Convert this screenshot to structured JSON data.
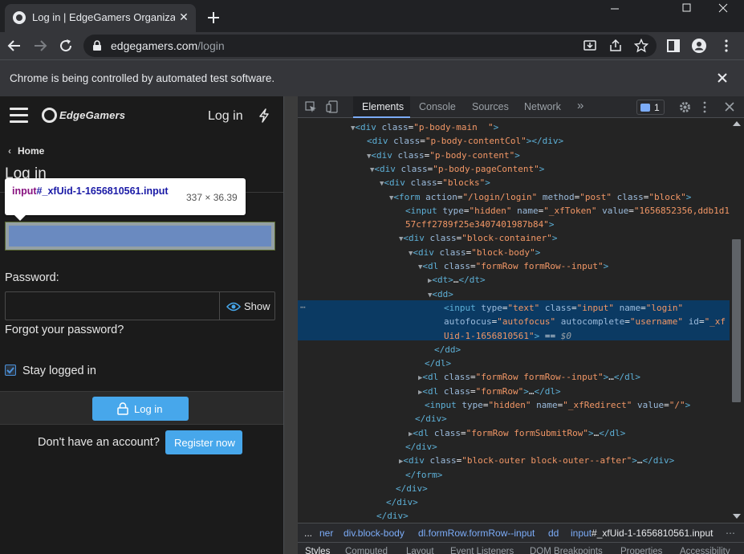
{
  "browser": {
    "tab_title": "Log in | EdgeGamers Organizatio",
    "url_domain": "edgegamers.com",
    "url_path": "/login",
    "infobar_message": "Chrome is being controlled by automated test software."
  },
  "site": {
    "logo_text": "EdgeGamers",
    "header_login": "Log in",
    "breadcrumb": "Home",
    "page_title": "Log in",
    "password_label": "Password:",
    "show_label": "Show",
    "forgot_password": "Forgot your password?",
    "stay_logged_in": "Stay logged in",
    "login_button": "Log in",
    "no_account": "Don't have an account?",
    "register_button": "Register now"
  },
  "tooltip": {
    "selector_tag": "input",
    "selector_rest": "#_xfUid-1-1656810561.input",
    "dimensions": "337 × 36.39"
  },
  "devtools": {
    "tabs": [
      "Elements",
      "Console",
      "Sources",
      "Network"
    ],
    "issues_count": "1",
    "dom_lines": [
      {
        "html": "<span class=\"arrow\">▼</span><span class=\"tag\">&lt;div</span> <span class=\"an\">class</span>=<span class=\"av\">\"p-body-main  \"</span><span class=\"tag\">&gt;</span>"
      },
      {
        "html": "<span class=\"tag\">&lt;div</span> <span class=\"an\">class</span>=<span class=\"av\">\"p-body-contentCol\"</span><span class=\"tag\">&gt;&lt;/div&gt;</span>"
      },
      {
        "html": "<span class=\"arrow\">▼</span><span class=\"tag\">&lt;div</span> <span class=\"an\">class</span>=<span class=\"av\">\"p-body-content\"</span><span class=\"tag\">&gt;</span>"
      },
      {
        "html": "<span class=\"arrow\">▼</span><span class=\"tag\">&lt;div</span> <span class=\"an\">class</span>=<span class=\"av\">\"p-body-pageContent\"</span><span class=\"tag\">&gt;</span>"
      },
      {
        "html": "<span class=\"arrow\">▼</span><span class=\"tag\">&lt;div</span> <span class=\"an\">class</span>=<span class=\"av\">\"blocks\"</span><span class=\"tag\">&gt;</span>"
      },
      {
        "html": "<span class=\"arrow\">▼</span><span class=\"tag\">&lt;form</span> <span class=\"an\">action</span>=<span class=\"av\">\"/login/login\"</span> <span class=\"an\">method</span>=<span class=\"av\">\"post\"</span> <span class=\"an\">class</span>=<span class=\"av\">\"block\"</span><span class=\"tag\">&gt;</span>"
      },
      {
        "html": "<span class=\"tag\">&lt;input</span> <span class=\"an\">type</span>=<span class=\"av\">\"hidden\"</span> <span class=\"an\">name</span>=<span class=\"av\">\"_xfToken\"</span> <span class=\"an\">value</span>=<span class=\"av\">\"1656852356,ddb1d1</span>"
      },
      {
        "html": "<span class=\"av\">57cff2789f25e3407401987b84\"</span><span class=\"tag\">&gt;</span>"
      },
      {
        "html": "<span class=\"arrow\">▼</span><span class=\"tag\">&lt;div</span> <span class=\"an\">class</span>=<span class=\"av\">\"block-container\"</span><span class=\"tag\">&gt;</span>"
      },
      {
        "html": "<span class=\"arrow\">▼</span><span class=\"tag\">&lt;div</span> <span class=\"an\">class</span>=<span class=\"av\">\"block-body\"</span><span class=\"tag\">&gt;</span>"
      },
      {
        "html": "<span class=\"arrow\">▼</span><span class=\"tag\">&lt;dl</span> <span class=\"an\">class</span>=<span class=\"av\">\"formRow formRow--input\"</span><span class=\"tag\">&gt;</span>"
      },
      {
        "html": "<span class=\"arrow\">▶</span><span class=\"tag\">&lt;dt&gt;</span>…<span class=\"tag\">&lt;/dt&gt;</span>"
      },
      {
        "html": "<span class=\"arrow\">▼</span><span class=\"tag\">&lt;dd&gt;</span>"
      },
      {
        "html": "<span class=\"tag\">&lt;input</span> <span class=\"an\">type</span>=<span class=\"av\">\"text\"</span> <span class=\"an\">class</span>=<span class=\"av\">\"input\"</span> <span class=\"an\">name</span>=<span class=\"av\">\"login\"</span>"
      },
      {
        "html": "<span class=\"an\">autofocus</span>=<span class=\"av\">\"autofocus\"</span> <span class=\"an\">autocomplete</span>=<span class=\"av\">\"username\"</span> <span class=\"an\">id</span>=<span class=\"av\">\"_xf</span>"
      },
      {
        "html": "<span class=\"av\">Uid-1-1656810561\"</span><span class=\"tag\">&gt;</span> == <span style=\"color:#9aa0a6;font-style:italic\">$0</span>"
      },
      {
        "html": "<span class=\"tag\">&lt;/dd&gt;</span>"
      },
      {
        "html": "<span class=\"tag\">&lt;/dl&gt;</span>"
      },
      {
        "html": "<span class=\"arrow\">▶</span><span class=\"tag\">&lt;dl</span> <span class=\"an\">class</span>=<span class=\"av\">\"formRow formRow--input\"</span><span class=\"tag\">&gt;</span>…<span class=\"tag\">&lt;/dl&gt;</span>"
      },
      {
        "html": "<span class=\"arrow\">▶</span><span class=\"tag\">&lt;dl</span> <span class=\"an\">class</span>=<span class=\"av\">\"formRow\"</span><span class=\"tag\">&gt;</span>…<span class=\"tag\">&lt;/dl&gt;</span>"
      },
      {
        "html": "<span class=\"tag\">&lt;input</span> <span class=\"an\">type</span>=<span class=\"av\">\"hidden\"</span> <span class=\"an\">name</span>=<span class=\"av\">\"_xfRedirect\"</span> <span class=\"an\">value</span>=<span class=\"av\">\"/\"</span><span class=\"tag\">&gt;</span>"
      },
      {
        "html": "<span class=\"tag\">&lt;/div&gt;</span>"
      },
      {
        "html": "<span class=\"arrow\">▶</span><span class=\"tag\">&lt;dl</span> <span class=\"an\">class</span>=<span class=\"av\">\"formRow formSubmitRow\"</span><span class=\"tag\">&gt;</span>…<span class=\"tag\">&lt;/dl&gt;</span>"
      },
      {
        "html": "<span class=\"tag\">&lt;/div&gt;</span>"
      },
      {
        "html": "<span class=\"arrow\">▶</span><span class=\"tag\">&lt;div</span> <span class=\"an\">class</span>=<span class=\"av\">\"block-outer block-outer--after\"</span><span class=\"tag\">&gt;</span>…<span class=\"tag\">&lt;/div&gt;</span>"
      },
      {
        "html": "<span class=\"tag\">&lt;/form&gt;</span>"
      },
      {
        "html": "<span class=\"tag\">&lt;/div&gt;</span>"
      },
      {
        "html": "<span class=\"tag\">&lt;/div&gt;</span>"
      },
      {
        "html": "<span class=\"tag\">&lt;/div&gt;</span>"
      }
    ],
    "crumbs": {
      "dots": "...",
      "c0": "ner",
      "c1": "div.block-body",
      "c2": "dl.formRow.formRow--input",
      "c3": "dd",
      "c4_tag": "input",
      "c4_rest": "#_xfUid-1-1656810561.input"
    },
    "bottom_tabs": [
      "Styles",
      "Computed",
      "Layout",
      "Event Listeners",
      "DOM Breakpoints",
      "Properties",
      "Accessibility"
    ]
  }
}
